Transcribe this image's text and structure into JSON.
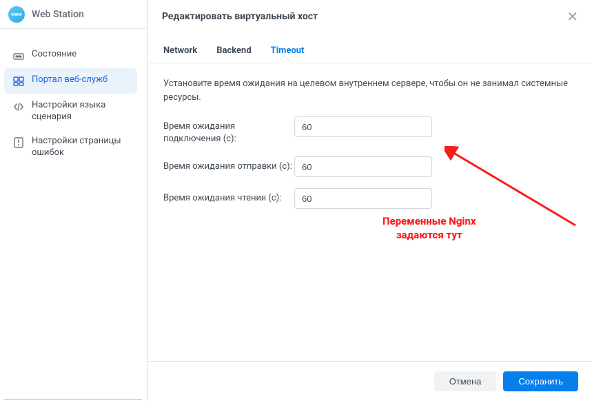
{
  "app": {
    "title": "Web Station"
  },
  "sidebar": {
    "items": [
      {
        "label": "Состояние"
      },
      {
        "label": "Портал веб-служб"
      },
      {
        "label": "Настройки языка сценария"
      },
      {
        "label": "Настройки страницы ошибок"
      }
    ]
  },
  "modal": {
    "title": "Редактировать виртуальный хост",
    "tabs": [
      {
        "label": "Network"
      },
      {
        "label": "Backend"
      },
      {
        "label": "Timeout"
      }
    ],
    "description": "Установите время ожидания на целевом внутреннем сервере, чтобы он не занимал системные ресурсы.",
    "fields": [
      {
        "label": "Время ожидания подключения (с):",
        "value": "60"
      },
      {
        "label": "Время ожидания отправки (с):",
        "value": "60"
      },
      {
        "label": "Время ожидания чтения (с):",
        "value": "60"
      }
    ],
    "footer": {
      "cancel": "Отмена",
      "save": "Сохранить"
    }
  },
  "annotation": {
    "line1": "Переменные Nginx",
    "line2": "задаются тут"
  }
}
